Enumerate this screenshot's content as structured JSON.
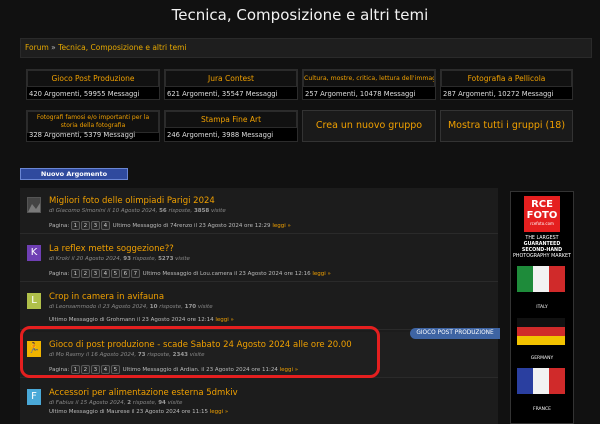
{
  "page": {
    "title": "Tecnica, Composizione e altri temi"
  },
  "breadcrumb": {
    "home": "Forum",
    "sep": " » ",
    "current": "Tecnica, Composizione e altri temi"
  },
  "groups": [
    {
      "title": "Gioco Post Produzione",
      "stats": "420 Argomenti, 59955 Messaggi"
    },
    {
      "title": "Jura Contest",
      "stats": "621 Argomenti, 35547 Messaggi"
    },
    {
      "title": "Cultura, mostre, critica, lettura dell'immagine",
      "stats": "257 Argomenti, 10478 Messaggi"
    },
    {
      "title": "Fotografia a Pellicola",
      "stats": "287 Argomenti, 10272 Messaggi"
    },
    {
      "title": "Fotografi famosi e/o importanti per la storia della fotografia",
      "stats": "328 Argomenti, 5379 Messaggi"
    },
    {
      "title": "Stampa Fine Art",
      "stats": "246 Argomenti, 3988 Messaggi"
    }
  ],
  "actions": {
    "create_group": "Crea un nuovo gruppo",
    "show_all": "Mostra tutti i gruppi (18)"
  },
  "new_topic_label": "Nuovo Argomento",
  "pages_label": "Pagina:",
  "more_label": "leggi »",
  "topics": [
    {
      "avatar": "",
      "avatar_bg": "#333",
      "title": "Migliori foto delle olimpiadi Parigi 2024",
      "meta_pre": "di Giacomo Simonini il 10 Agosto 2024, ",
      "replies": "56",
      "meta_mid": " risposte, ",
      "views": "3858",
      "meta_post": " visite",
      "pages": [
        "1",
        "2",
        "3",
        "4"
      ],
      "last": "Ultimo Messaggio di 74renzo il 23 Agosto 2024 ore 12:29"
    },
    {
      "avatar": "K",
      "avatar_bg": "#6f3fb4",
      "title": "La reflex mette soggezione??",
      "meta_pre": "di Kroki il 20 Agosto 2024, ",
      "replies": "93",
      "meta_mid": " risposte, ",
      "views": "5273",
      "meta_post": " visite",
      "pages": [
        "1",
        "2",
        "3",
        "4",
        "5",
        "6",
        "7"
      ],
      "last": "Ultimo Messaggio di Lou.camera il 23 Agosto 2024 ore 12:16"
    },
    {
      "avatar": "L",
      "avatar_bg": "#b0c04a",
      "title": "Crop in camera in avifauna",
      "meta_pre": "di Leonsammodo il 23 Agosto 2024, ",
      "replies": "10",
      "meta_mid": " risposte, ",
      "views": "170",
      "meta_post": " visite",
      "pages": [],
      "last": "Ultimo Messaggio di Grohmann il 23 Agosto 2024 ore 12:14"
    },
    {
      "avatar": "🏃",
      "avatar_bg": "#f0b400",
      "title": "Gioco di post produzione - scade Sabato 24 Agosto 2024 alle ore 20.00",
      "meta_pre": "di Mo Rasmy il 16 Agosto 2024, ",
      "replies": "73",
      "meta_mid": " risposte, ",
      "views": "2343",
      "meta_post": " visite",
      "pages": [
        "1",
        "2",
        "3",
        "4",
        "5"
      ],
      "last": "Ultimo Messaggio di Ardian. il 23 Agosto 2024 ore 11:24"
    },
    {
      "avatar": "F",
      "avatar_bg": "#4aa9d8",
      "title": "Accessori per alimentazione esterna 5dmkiv",
      "meta_pre": "di Fabius il 15 Agosto 2024, ",
      "replies": "2",
      "meta_mid": " risposte, ",
      "views": "94",
      "meta_post": " visite",
      "pages": [],
      "last": "Ultimo Messaggio di Maurese il 23 Agosto 2024 ore 11:15"
    }
  ],
  "badge": "GIOCO POST PRODUZIONE",
  "ad": {
    "logo_top": "RCE",
    "logo_bottom": "FOTO",
    "site": "rcefoto.com",
    "line1": "THE LARGEST",
    "line2": "GUARANTEED SECOND-HAND",
    "line3": "PHOTOGRAPHY MARKET",
    "countries": [
      "ITALY",
      "GERMANY",
      "FRANCE"
    ],
    "colors": {
      "accent": "#e51f1f"
    }
  }
}
